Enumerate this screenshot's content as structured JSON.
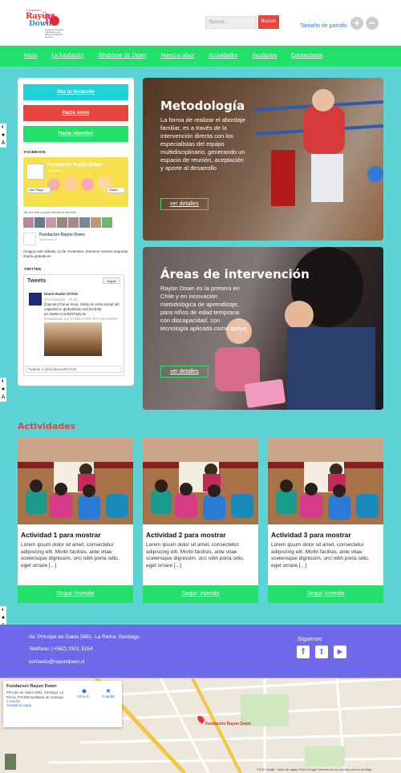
{
  "header": {
    "logo": {
      "top": "Fundación",
      "rayun": "Rayün",
      "down": "Down",
      "tagline": "Fundación de Ayuda y Educación para Niños con Síndrome de Down"
    },
    "search_placeholder": "Buscar...",
    "search_button": "Buscar",
    "font_size_label": "Tamaño de parrafo",
    "zoom_in": "+",
    "zoom_out": "−"
  },
  "nav": {
    "items": [
      "Inicio",
      "La fundación",
      "Síndrome de Down",
      "Nuestra labor",
      "Actividades",
      "Ayudanos",
      "Contactanos"
    ]
  },
  "side_tabs": [
    "A",
    "A",
    "A"
  ],
  "sidebar": {
    "buttons": [
      {
        "label": "Haz tu donación",
        "color": "#1fd3d6"
      },
      {
        "label": "Hazte socio",
        "color": "#e9443e"
      },
      {
        "label": "Hazte miembro",
        "color": "#22e06a"
      }
    ],
    "facebook_heading": "FACEBOOK",
    "fb_page_name": "Fundación Rayün Down",
    "fb_likes": "2,201 likes",
    "fb_like": "Like Page",
    "fb_share": "Share",
    "fb_friends_text": "Be the first of your friends to like this",
    "fb_post_name": "Fundación Rayün Down",
    "fb_post_date": "November 9",
    "fb_post_text": "Amigos este sábado 14 de noviembre, tenemos nuestra segunda charla gratuita en",
    "twitter_heading": "TWITTER",
    "tw_title": "Tweets",
    "tw_follow": "Seguir",
    "tw_author": "Diario-Radio UChile",
    "tw_handle": "@uchileradio · 10 dic",
    "tw_text": "[Opinión] Grinor Rojo: Sobre la crisis actual del capitalismo globalizado owl.li/VJl3Q pic.twitter.com/MXF2pvJIx",
    "tw_retweet": "Retwitteado por FUNDACION RAYUN DOWN",
    "tw_input": "Twittear a @fundacionRAYUN"
  },
  "panels": [
    {
      "title": "Metodología",
      "text": "La forma de realizar el abordaje familiar, es a través de la intervención directa con los especialistas del equipo multidisciplinario, generando un espacio de reunión, aceptación y aporte al desarrollo",
      "link": "ver detalles"
    },
    {
      "title": "Áreas de intervención",
      "text": "Rayün Down es la primera en Chile y en innovación metodológica de aprendizaje, para niños de edad temprana con discapacidad, con tecnología aplicada como apoyo",
      "link": "ver detalles"
    }
  ],
  "activities": {
    "title": "Actividades",
    "items": [
      {
        "title": "Actividad 1 para mostrar",
        "text": "Lorem ipsum dolor sit amet, consectetur adipiscing elit. Morbi facilisis, ante vitae scelerisque dignissim, orci nibh porta odio, eget ornare [...]",
        "link": "Seguir leyendo"
      },
      {
        "title": "Actividad 2 para mostrar",
        "text": "Lorem ipsum dolor sit amet, consectetur adipiscing elit. Morbi facilisis, ante vitae scelerisque dignissim, orci nibh porta odio, eget ornare [...]",
        "link": "Seguir leyendo"
      },
      {
        "title": "Actividad 3 para mostrar",
        "text": "Lorem ipsum dolor sit amet, consectetur adipiscing elit. Morbi facilisis, ante vitae scelerisque dignissim, orci nibh porta odio, eget ornare [...]",
        "link": "Seguir leyendo"
      }
    ]
  },
  "footer": {
    "address": "Av. Príncipe de Gales 5861, La Reina, Santiago.",
    "phone": "Teléfono: (+562) 2501 5154",
    "email": "contacto@rayundown.cl",
    "follow": "Síguenos:",
    "social": [
      {
        "icon": "facebook-icon",
        "glyph": "f"
      },
      {
        "icon": "twitter-icon",
        "glyph": "t"
      },
      {
        "icon": "youtube-icon",
        "glyph": "▶"
      }
    ]
  },
  "map": {
    "name": "Fundacion Rayun Down",
    "address": "Principe de Gales 5861, Santiago, La Reina, XIII Metropolitana de Santiago",
    "reviews": "1 reseña",
    "enlarge": "Ampliar el mapa",
    "directions": "Cómo ll...",
    "save": "Guardar",
    "marker_label": "Fundación Rayun Down",
    "attribution": "©2015 Google · Datos de mapas ©2015 Google   Términos de uso   Informar un error de Maps"
  }
}
